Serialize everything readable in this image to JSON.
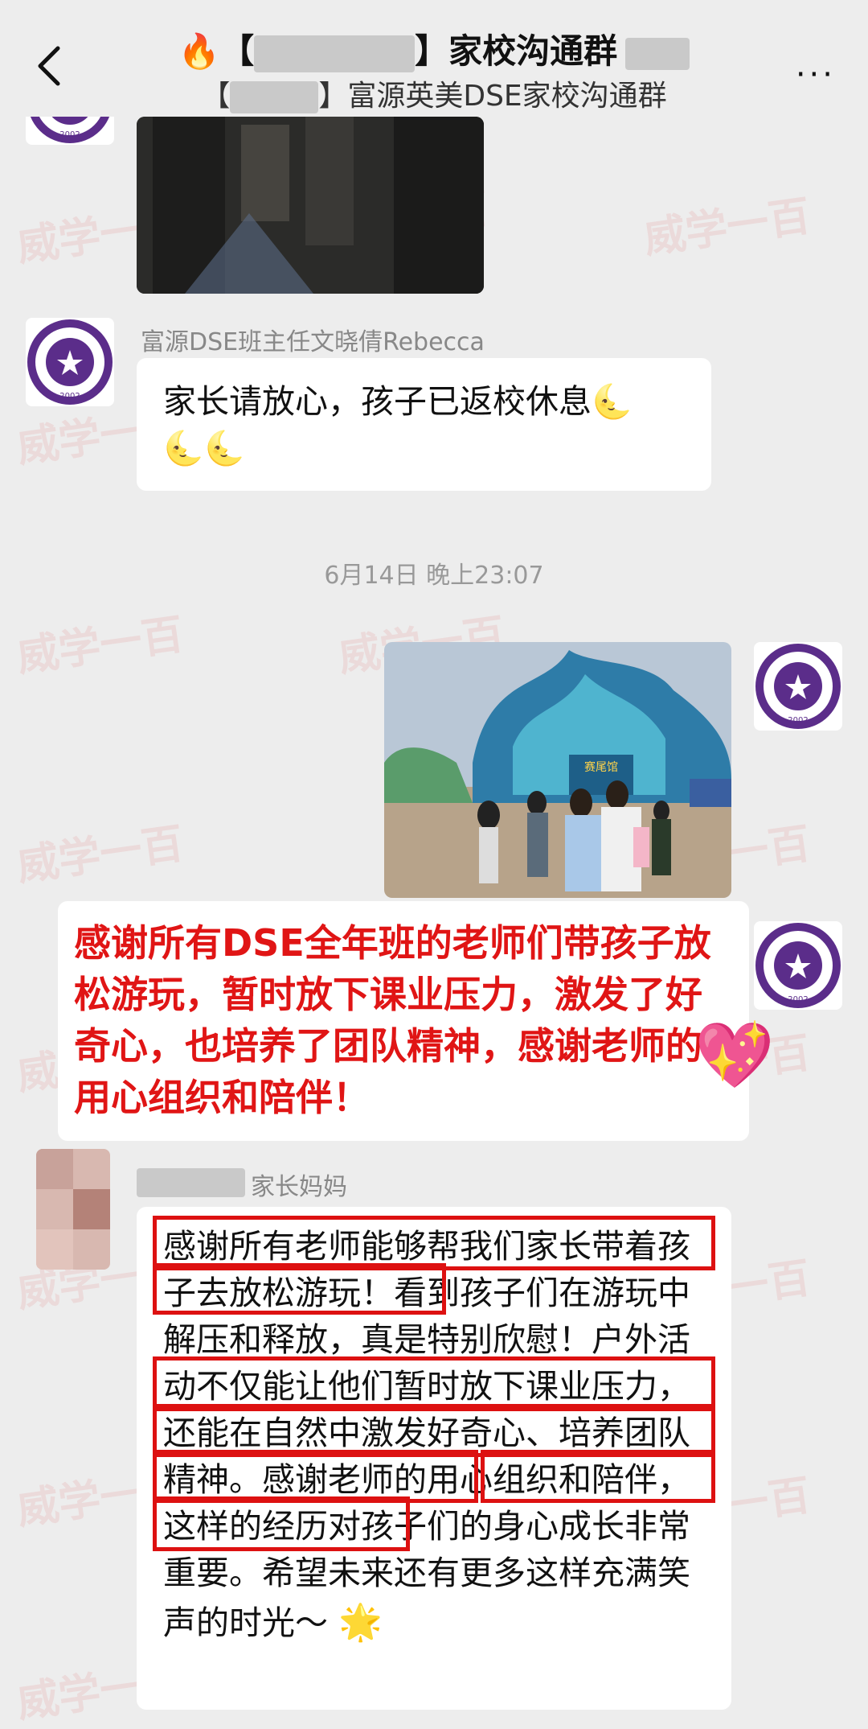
{
  "header": {
    "title_prefix": "🔥【",
    "title_suffix": "】家校沟通群",
    "subtitle_prefix": "【",
    "subtitle_suffix": "】富源英美DSE家校沟通群",
    "more": "···"
  },
  "messages": {
    "rebecca_name": "富源DSE班主任文晓倩Rebecca",
    "rebecca_text": "家长请放心，孩子已返校休息",
    "moon_emoji": "🌜",
    "timestamp": "6月14日 晚上23:07",
    "sign_text": "赛尾馆",
    "red_text": "感谢所有DSE全年班的老师们带孩子放松游玩，暂时放下课业压力，激发了好奇心，也培养了团队精神，感谢老师的用心组织和陪伴！",
    "heart_emoji": "💖",
    "parent_name": "家长妈妈",
    "parent_text": "感谢所有老师能够帮我们家长带着孩子去放松游玩！看到孩子们在游玩中解压和释放，真是特别欣慰！户外活动不仅能让他们暂时放下课业压力，还能在自然中激发好奇心、培养团队精神。感谢老师的用心组织和陪伴，这样的经历对孩子们的身心成长非常重要。希望未来还有更多这样充满笑声的时光～",
    "star_emoji": "🌟"
  },
  "school_logo": {
    "year": "2002"
  },
  "watermark": "威学一百",
  "colors": {
    "background": "#ededed",
    "accent_red": "#e01515",
    "school_purple": "#5b2d8a"
  }
}
